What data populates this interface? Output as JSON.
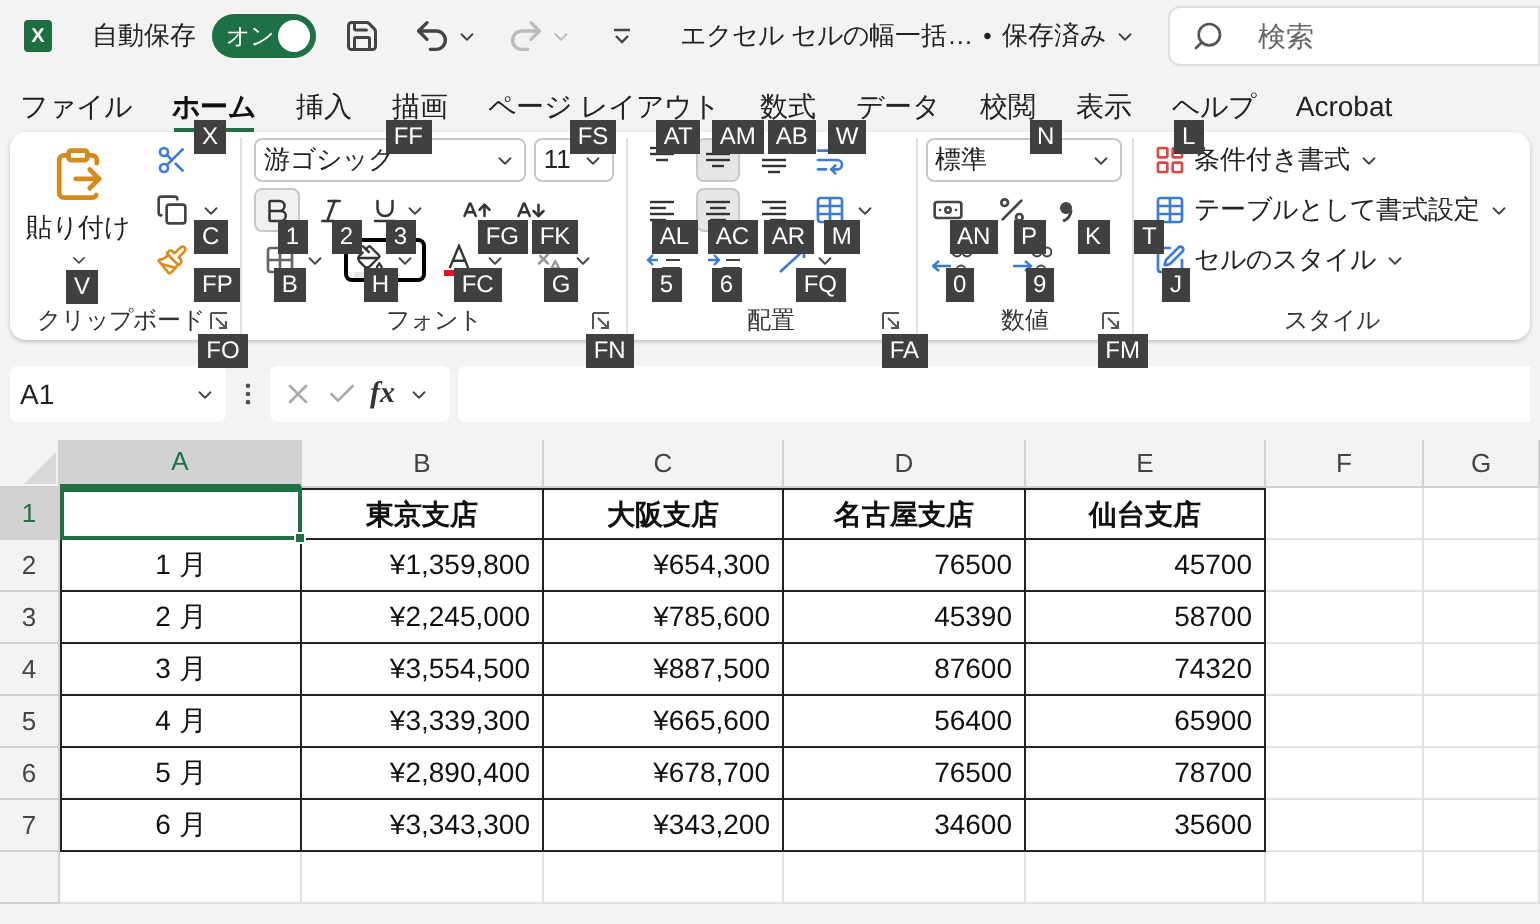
{
  "title_bar": {
    "app_icon_letter": "X",
    "autosave_label": "自動保存",
    "autosave_toggle": {
      "label": "オン",
      "on": true
    },
    "document_title": "エクセル セルの幅一括…",
    "separator": "•",
    "save_status": "保存済み",
    "search": {
      "placeholder": "検索"
    }
  },
  "tabs": [
    {
      "label": "ファイル",
      "selected": false
    },
    {
      "label": "ホーム",
      "selected": true
    },
    {
      "label": "挿入",
      "selected": false
    },
    {
      "label": "描画",
      "selected": false
    },
    {
      "label": "ページ レイアウト",
      "selected": false
    },
    {
      "label": "数式",
      "selected": false
    },
    {
      "label": "データ",
      "selected": false
    },
    {
      "label": "校閲",
      "selected": false
    },
    {
      "label": "表示",
      "selected": false
    },
    {
      "label": "ヘルプ",
      "selected": false
    },
    {
      "label": "Acrobat",
      "selected": false
    }
  ],
  "clipboard": {
    "label": "クリップボード",
    "launcher_keytip": "FO",
    "paste": {
      "label": "貼り付け",
      "keytip": "V"
    },
    "cut_keytip": "X",
    "copy_keytip": "C",
    "format_painter_keytip": "FP"
  },
  "font": {
    "label": "フォント",
    "launcher_keytip": "FN",
    "font_name": {
      "value": "游ゴシック",
      "keytip": "FF"
    },
    "font_size": {
      "value": "11",
      "keytip": "FS"
    },
    "style_buttons": [
      {
        "kind": "bold",
        "keytip": "1"
      },
      {
        "kind": "italic",
        "keytip": "2"
      },
      {
        "kind": "underline",
        "keytip": "3"
      },
      {
        "kind": "grow",
        "keytip": "FG"
      },
      {
        "kind": "shrink",
        "keytip": "FK"
      }
    ],
    "color_buttons": [
      {
        "kind": "border",
        "keytip": "B",
        "focused": false
      },
      {
        "kind": "fill",
        "keytip": "H",
        "focused": true
      },
      {
        "kind": "font_color",
        "keytip": "FC",
        "focused": false
      },
      {
        "kind": "phonetic",
        "keytip": "G",
        "focused": false
      }
    ]
  },
  "alignment": {
    "label": "配置",
    "launcher_keytip": "FA",
    "wrap_keytip": "W",
    "merge_keytip": "M",
    "orientation_keytip": "FQ",
    "vertical": [
      {
        "kind": "top",
        "keytip": "AT",
        "selected": false
      },
      {
        "kind": "middle",
        "keytip": "AM",
        "selected": true
      },
      {
        "kind": "bottom",
        "keytip": "AB",
        "selected": false
      }
    ],
    "horizontal": [
      {
        "kind": "left",
        "keytip": "AL",
        "selected": false
      },
      {
        "kind": "center",
        "keytip": "AC",
        "selected": true
      },
      {
        "kind": "right",
        "keytip": "AR",
        "selected": false
      }
    ],
    "indent": [
      {
        "kind": "decrease",
        "keytip": "5"
      },
      {
        "kind": "increase",
        "keytip": "6"
      }
    ]
  },
  "number": {
    "label": "数値",
    "launcher_keytip": "FM",
    "format": {
      "value": "標準",
      "keytip": "N"
    },
    "buttons": [
      {
        "kind": "accounting",
        "keytip": "AN"
      },
      {
        "kind": "percent",
        "keytip": "P"
      },
      {
        "kind": "comma",
        "keytip": "K"
      }
    ],
    "decimal_buttons": [
      {
        "kind": "decrease",
        "keytip": "0"
      },
      {
        "kind": "increase",
        "keytip": "9"
      }
    ]
  },
  "styles": {
    "label": "スタイル",
    "items": [
      {
        "kind": "conditional",
        "label": "条件付き書式",
        "keytip": "L"
      },
      {
        "kind": "table",
        "label": "テーブルとして書式設定",
        "keytip": "T"
      },
      {
        "kind": "cell",
        "label": "セルのスタイル",
        "keytip": "J"
      }
    ]
  },
  "formula_bar": {
    "name_box": "A1",
    "function_label": "fx"
  },
  "sheet": {
    "columns": [
      {
        "label": "A",
        "selected": true
      },
      {
        "label": "B",
        "selected": false
      },
      {
        "label": "C",
        "selected": false
      },
      {
        "label": "D",
        "selected": false
      },
      {
        "label": "E",
        "selected": false
      },
      {
        "label": "F",
        "selected": false
      },
      {
        "label": "G",
        "selected": false
      }
    ],
    "header_row": {
      "number": "1",
      "selected": true,
      "cells": [
        "東京支店",
        "大阪支店",
        "名古屋支店",
        "仙台支店"
      ]
    },
    "rows": [
      {
        "number": "2",
        "selected": false,
        "month": "1 月",
        "values": [
          "¥1,359,800",
          "¥654,300",
          "76500",
          "45700"
        ]
      },
      {
        "number": "3",
        "selected": false,
        "month": "2 月",
        "values": [
          "¥2,245,000",
          "¥785,600",
          "45390",
          "58700"
        ]
      },
      {
        "number": "4",
        "selected": false,
        "month": "3 月",
        "values": [
          "¥3,554,500",
          "¥887,500",
          "87600",
          "74320"
        ]
      },
      {
        "number": "5",
        "selected": false,
        "month": "4 月",
        "values": [
          "¥3,339,300",
          "¥665,600",
          "56400",
          "65900"
        ]
      },
      {
        "number": "6",
        "selected": false,
        "month": "5 月",
        "values": [
          "¥2,890,400",
          "¥678,700",
          "76500",
          "78700"
        ]
      },
      {
        "number": "7",
        "selected": false,
        "month": "6 月",
        "values": [
          "¥3,343,300",
          "¥343,200",
          "34600",
          "35600"
        ]
      }
    ]
  }
}
